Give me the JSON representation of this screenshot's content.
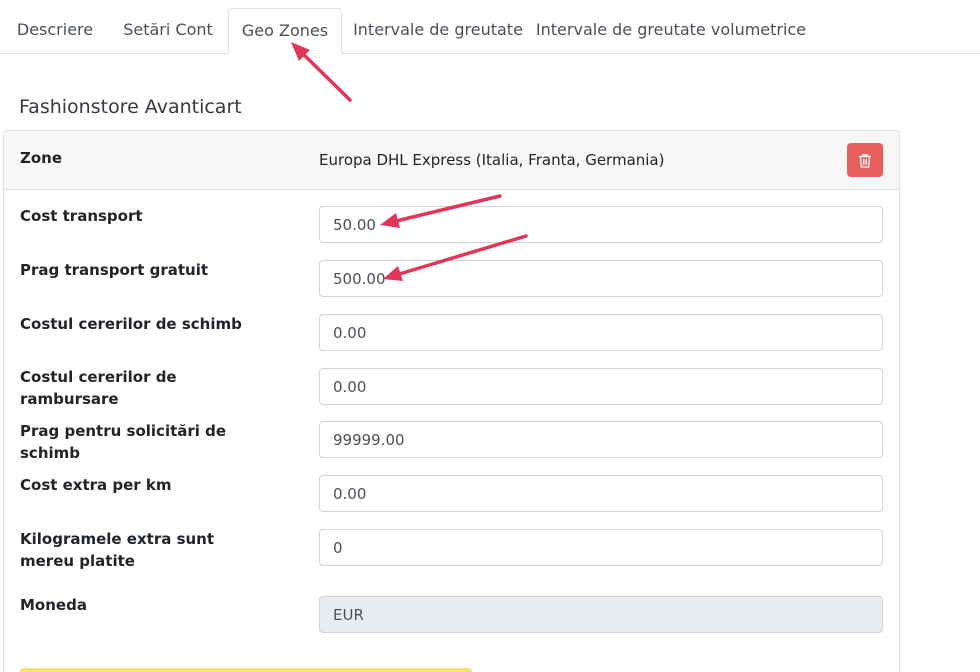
{
  "tabs": [
    {
      "label": "Descriere",
      "active": false
    },
    {
      "label": "Setări Cont",
      "active": false
    },
    {
      "label": "Geo Zones",
      "active": true
    },
    {
      "label": "Intervale de greutate",
      "active": false
    },
    {
      "label": "Intervale de greutate volumetrice",
      "active": false
    }
  ],
  "store": {
    "title": "Fashionstore Avanticart"
  },
  "zone": {
    "label": "Zone",
    "value": "Europa DHL Express (Italia, Franta, Germania)",
    "delete_icon": "trash-icon"
  },
  "fields": [
    {
      "label": "Cost transport",
      "value": "50.00",
      "readonly": false
    },
    {
      "label": "Prag transport gratuit",
      "value": "500.00",
      "readonly": false
    },
    {
      "label": "Costul cererilor de schimb",
      "value": "0.00",
      "readonly": false
    },
    {
      "label": "Costul cererilor de rambursare",
      "value": "0.00",
      "readonly": false
    },
    {
      "label": "Prag pentru solicitări de schimb",
      "value": "99999.00",
      "readonly": false
    },
    {
      "label": "Cost extra per km",
      "value": "0.00",
      "readonly": false
    },
    {
      "label": "Kilogramele extra sunt mereu platite",
      "value": "0",
      "readonly": false
    },
    {
      "label": "Moneda",
      "value": "EUR",
      "readonly": true
    }
  ],
  "colors": {
    "delete_button": "#e8605d",
    "annotation_arrow": "#e0365a",
    "strip": "#f7e36a"
  }
}
